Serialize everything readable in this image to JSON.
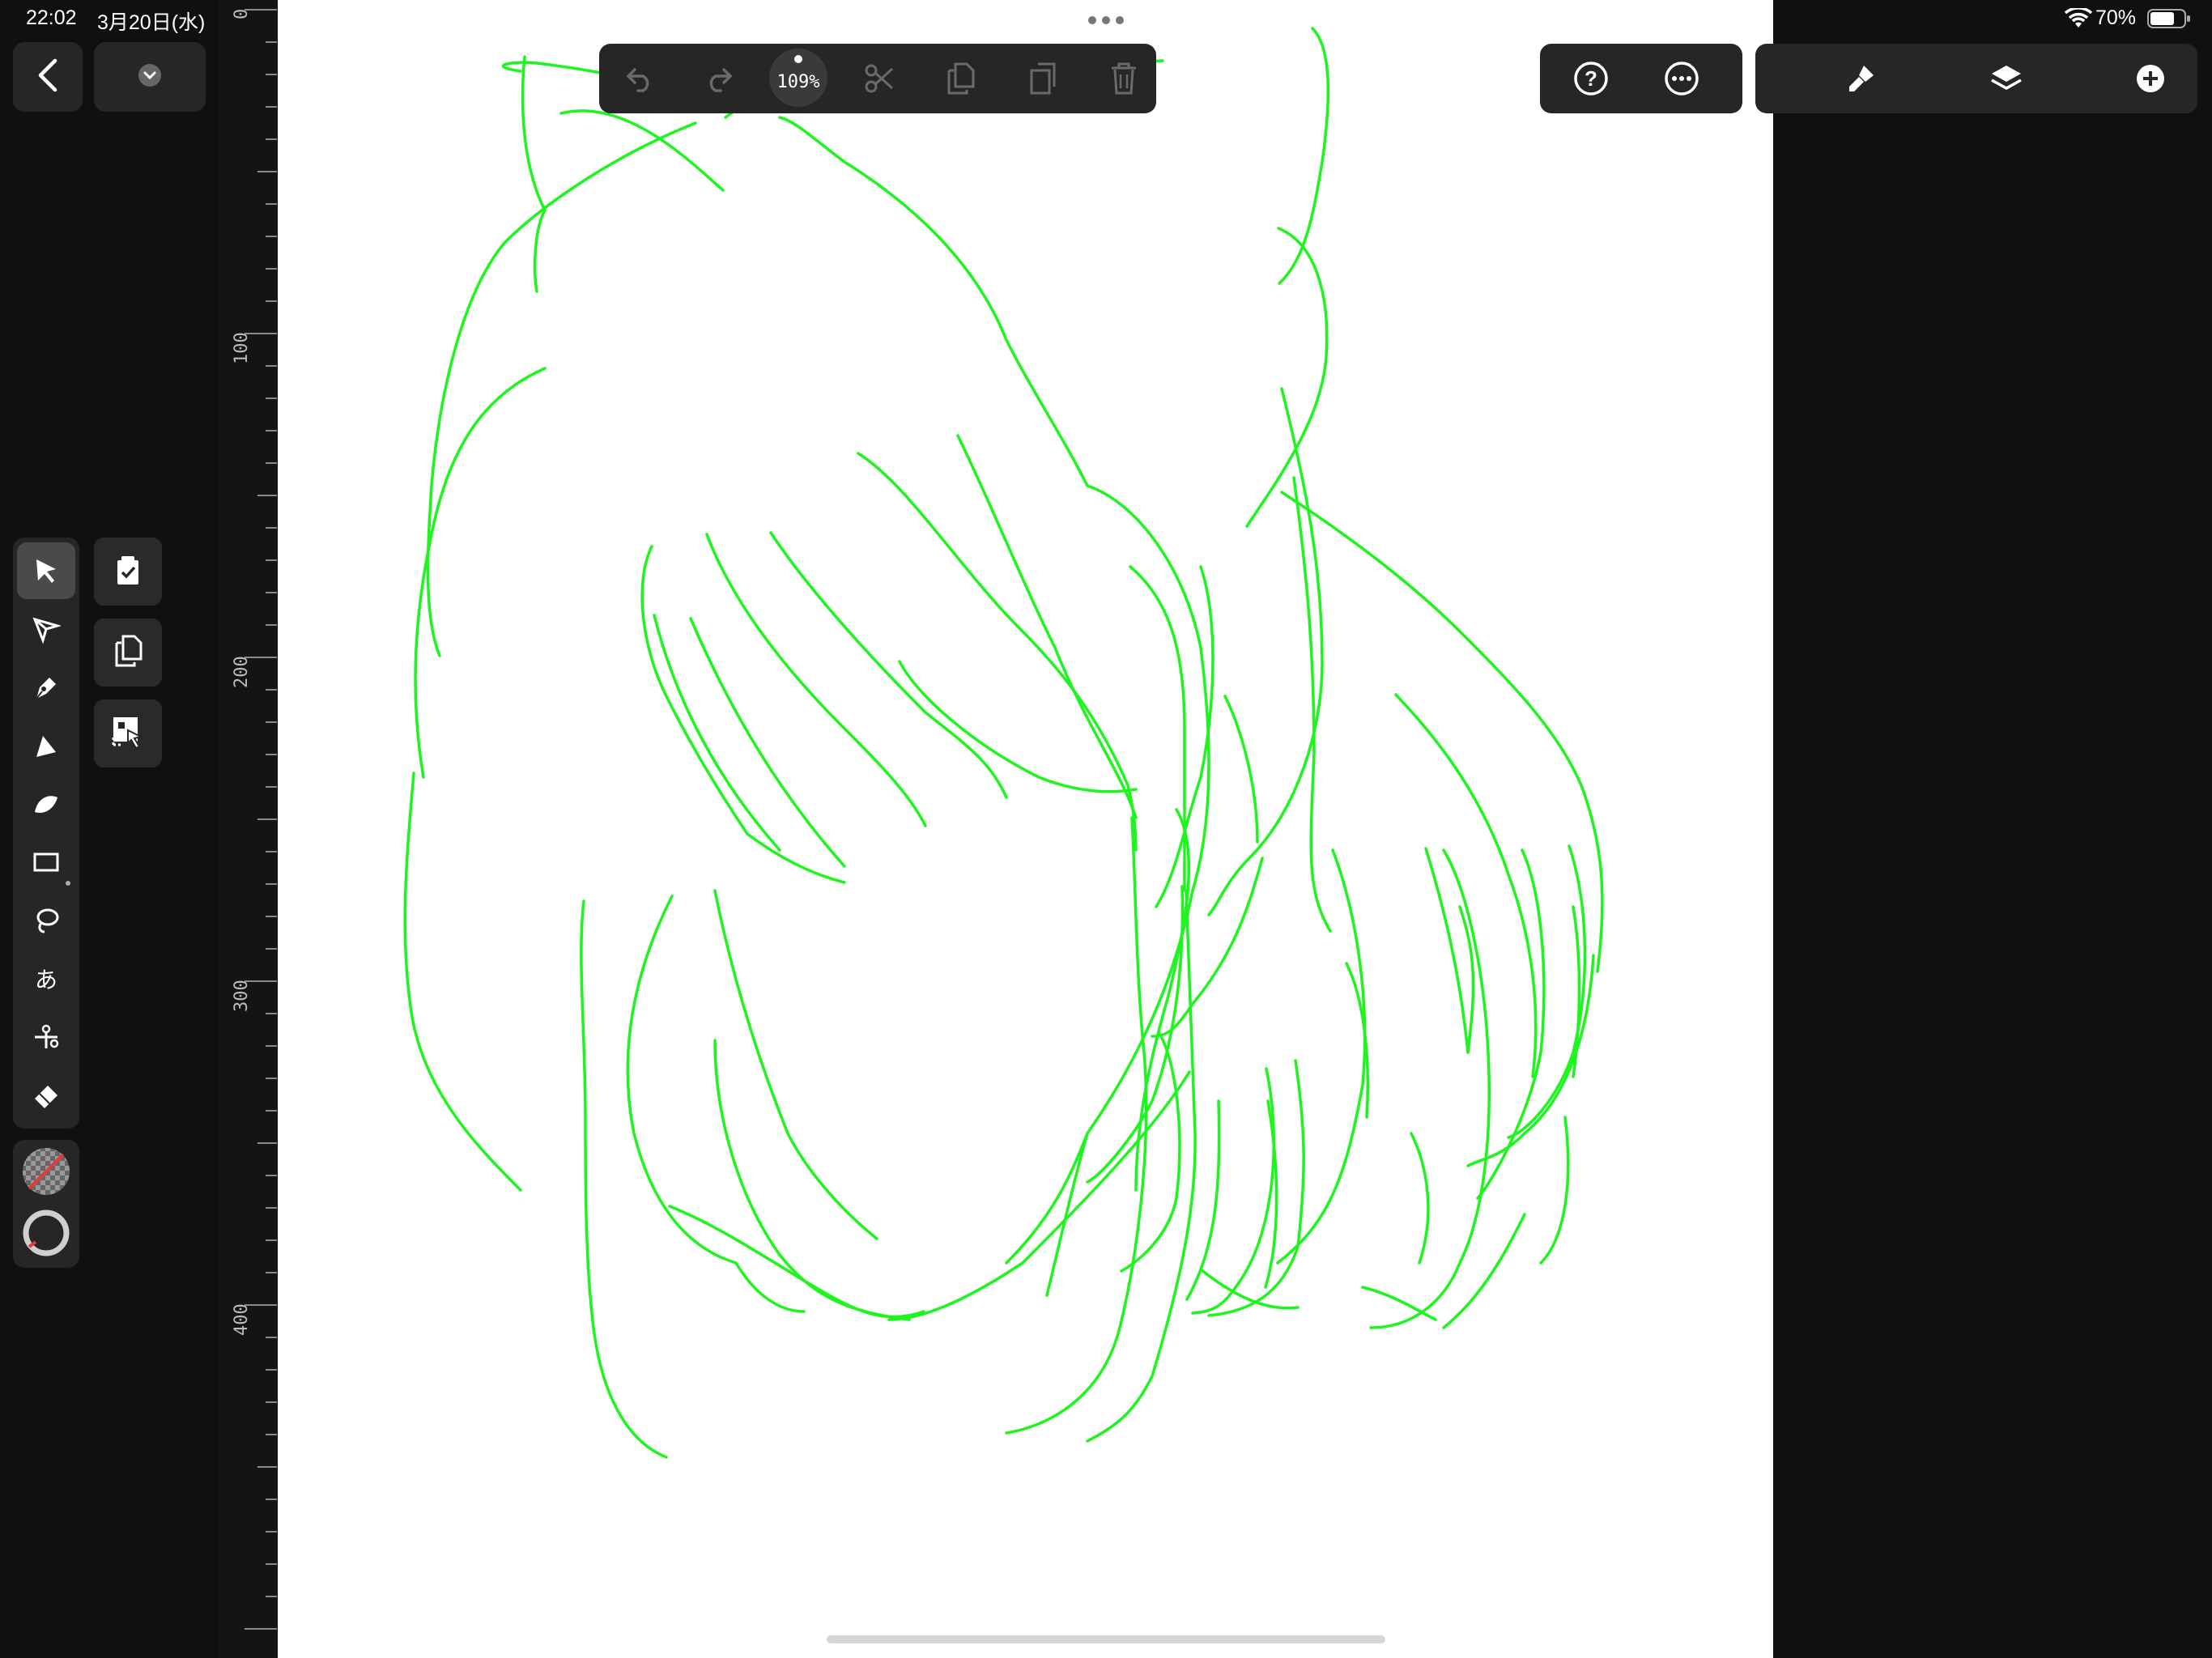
{
  "status_bar": {
    "time": "22:02",
    "date": "3月20日(水)",
    "battery": "70%",
    "wifi_icon": "wifi-icon",
    "battery_icon": "battery-icon"
  },
  "top_left": {
    "back_icon": "chevron-left-icon",
    "menu_icon": "chevron-down-icon"
  },
  "toolbar": {
    "undo_icon": "undo-icon",
    "redo_icon": "redo-icon",
    "zoom": "109%",
    "cut_icon": "scissors-icon",
    "copy_icon": "copy-icon",
    "paste_icon": "paste-icon",
    "delete_icon": "trash-icon"
  },
  "right_toolbar": {
    "help_icon": "help-icon",
    "more_icon": "more-icon",
    "brush_settings_icon": "brush-settings-icon",
    "layers_icon": "layers-icon",
    "add_icon": "add-icon"
  },
  "more_dots_icon": "ellipsis-icon",
  "ruler": {
    "labels": [
      "0",
      "100",
      "200",
      "300",
      "400"
    ]
  },
  "tools": [
    "select-tool",
    "node-tool",
    "pen-tool",
    "vector-brush-tool",
    "fill-tool",
    "shape-tool",
    "lasso-tool",
    "text-tool",
    "scissors-tool",
    "eraser-tool"
  ],
  "context_actions": [
    "clipboard-check",
    "duplicate",
    "transform"
  ],
  "colors": {
    "stroke": "#1ef51e",
    "panel": "#262626",
    "background": "#101010",
    "canvas": "#ffffff",
    "none_slash": "#e03a3a"
  }
}
